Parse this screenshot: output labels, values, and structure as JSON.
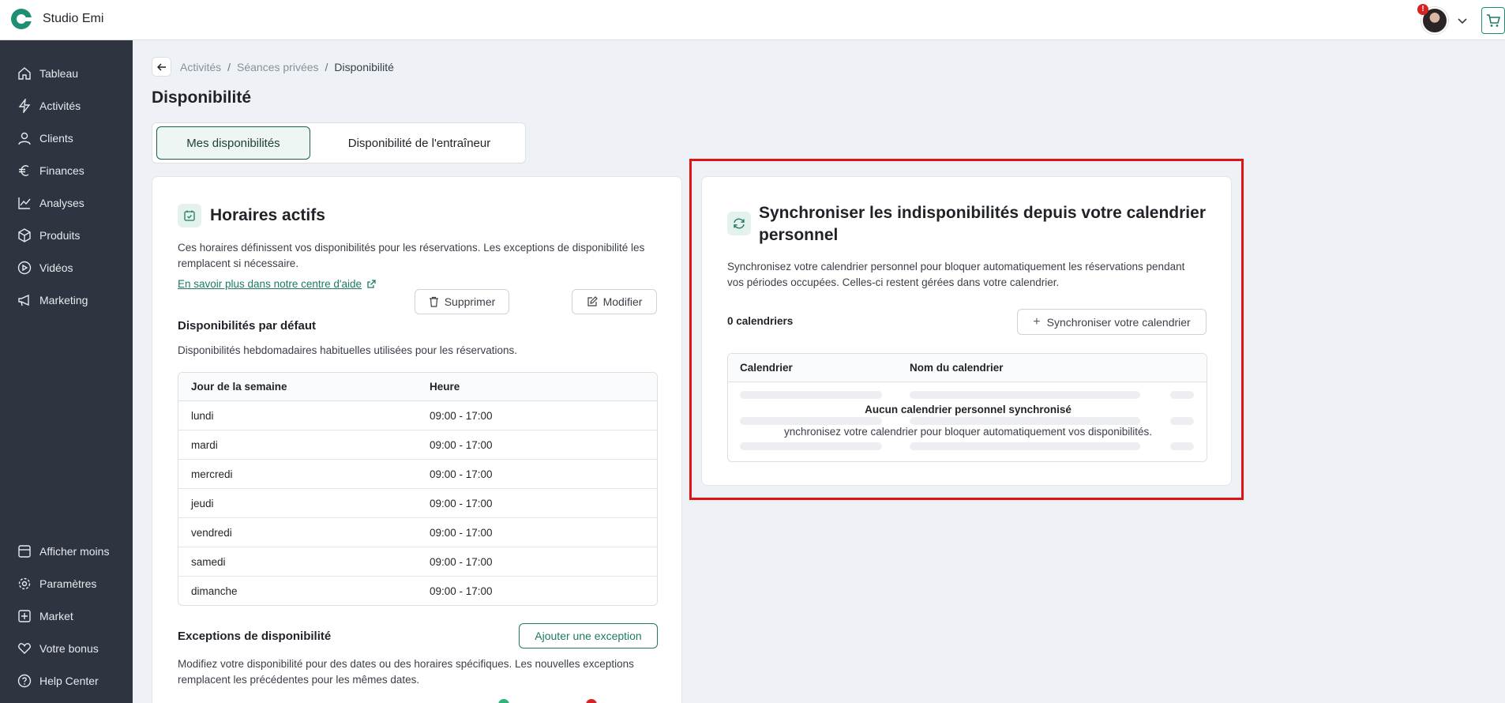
{
  "app": {
    "name": "Studio Emi",
    "notification_badge": "!"
  },
  "sidebar": {
    "items": [
      {
        "label": "Tableau",
        "icon": "home-icon"
      },
      {
        "label": "Activités",
        "icon": "bolt-icon"
      },
      {
        "label": "Clients",
        "icon": "user-icon"
      },
      {
        "label": "Finances",
        "icon": "euro-icon"
      },
      {
        "label": "Analyses",
        "icon": "chart-icon"
      },
      {
        "label": "Produits",
        "icon": "box-icon"
      },
      {
        "label": "Vidéos",
        "icon": "play-icon"
      },
      {
        "label": "Marketing",
        "icon": "megaphone-icon"
      }
    ],
    "bottom_items": [
      {
        "label": "Afficher moins",
        "icon": "panel-icon"
      },
      {
        "label": "Paramètres",
        "icon": "gear-icon"
      },
      {
        "label": "Market",
        "icon": "plus-square-icon"
      },
      {
        "label": "Votre bonus",
        "icon": "heart-icon"
      },
      {
        "label": "Help Center",
        "icon": "help-icon"
      }
    ]
  },
  "breadcrumb": {
    "items": [
      "Activités",
      "Séances privées",
      "Disponibilité"
    ]
  },
  "page": {
    "title": "Disponibilité"
  },
  "tabs": {
    "active": "Mes disponibilités",
    "other": "Disponibilité de l'entraîneur"
  },
  "horaires": {
    "title": "Horaires actifs",
    "description": "Ces horaires définissent vos disponibilités pour les réservations. Les exceptions de disponibilité les remplacent si nécessaire.",
    "link": "En savoir plus dans notre centre d'aide",
    "default_title": "Disponibilités par défaut",
    "delete_label": "Supprimer",
    "edit_label": "Modifier",
    "default_description": "Disponibilités hebdomadaires habituelles utilisées pour les réservations.",
    "table": {
      "headers": [
        "Jour de la semaine",
        "Heure"
      ],
      "rows": [
        [
          "lundi",
          "09:00 - 17:00"
        ],
        [
          "mardi",
          "09:00 - 17:00"
        ],
        [
          "mercredi",
          "09:00 - 17:00"
        ],
        [
          "jeudi",
          "09:00 - 17:00"
        ],
        [
          "vendredi",
          "09:00 - 17:00"
        ],
        [
          "samedi",
          "09:00 - 17:00"
        ],
        [
          "dimanche",
          "09:00 - 17:00"
        ]
      ]
    },
    "exceptions_title": "Exceptions de disponibilité",
    "add_exception_label": "Ajouter une exception",
    "exceptions_description": "Modifiez votre disponibilité pour des dates ou des horaires spécifiques. Les nouvelles exceptions remplacent les précédentes pour les mêmes dates."
  },
  "sync": {
    "title": "Synchroniser les indisponibilités depuis votre calendrier personnel",
    "description": "Synchronisez votre calendrier personnel pour bloquer automatiquement les réservations pendant vos périodes occupées. Celles-ci restent gérées dans votre calendrier.",
    "count": "0 calendriers",
    "button_label": "Synchroniser votre calendrier",
    "table_headers": [
      "Calendrier",
      "Nom du calendrier"
    ],
    "empty_title": "Aucun calendrier personnel synchronisé",
    "empty_subtitle": "ynchronisez votre calendrier pour bloquer automatiquement vos disponibilités."
  },
  "colors": {
    "sidebar": "#2e3440",
    "accent": "#1e7a64",
    "highlight": "#e01414",
    "background": "#eef1f6"
  }
}
